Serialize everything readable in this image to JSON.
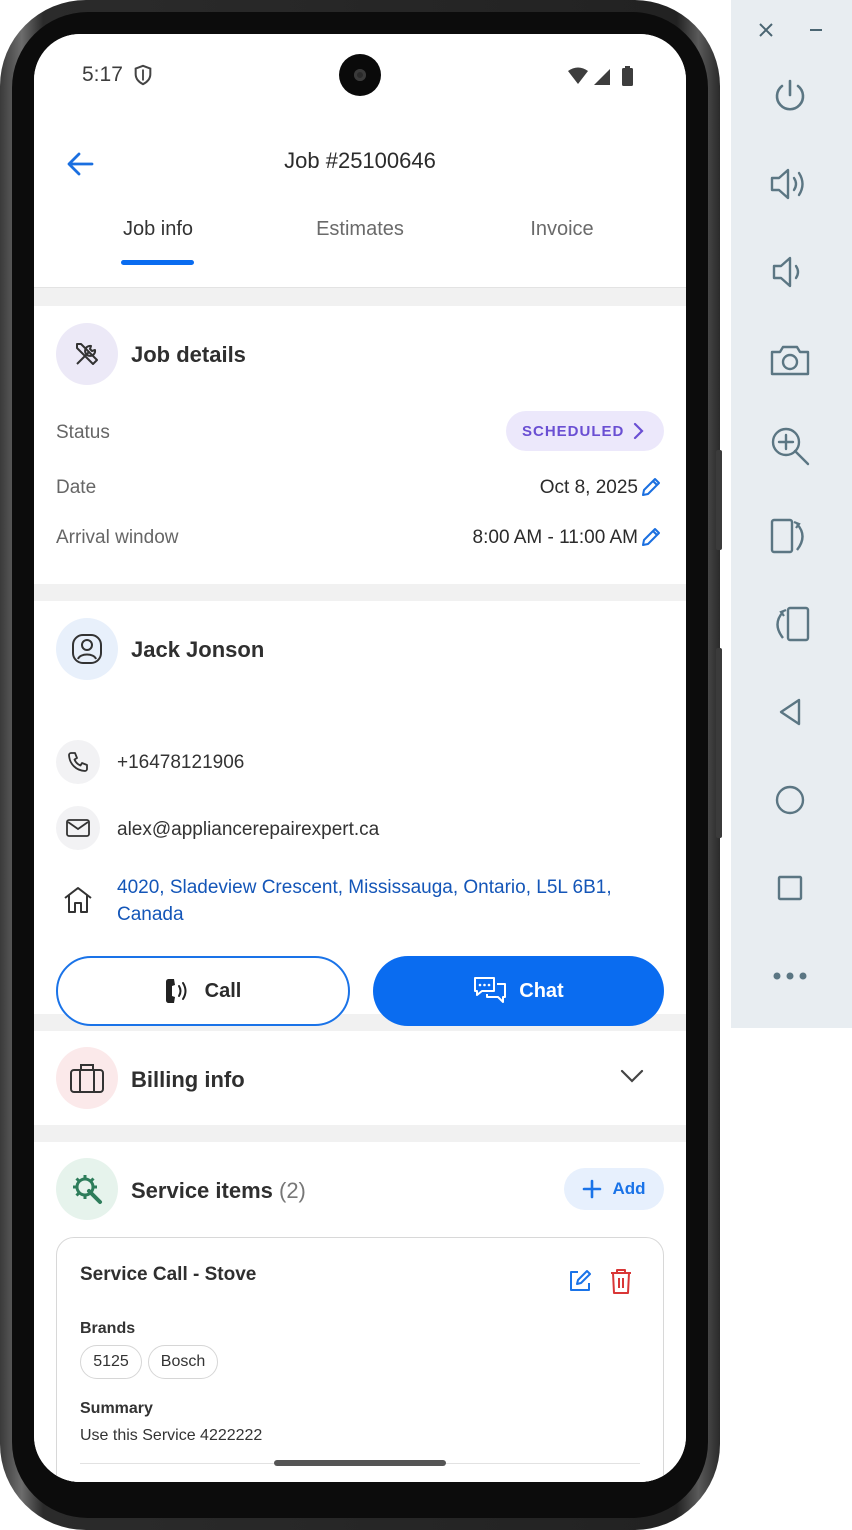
{
  "status_bar": {
    "time": "5:17"
  },
  "app_bar": {
    "title": "Job #25100646"
  },
  "tabs": [
    {
      "label": "Job info",
      "active": true
    },
    {
      "label": "Estimates",
      "active": false
    },
    {
      "label": "Invoice",
      "active": false
    }
  ],
  "job_details": {
    "heading": "Job details",
    "status_label": "Status",
    "status_value": "SCHEDULED",
    "date_label": "Date",
    "date_value": "Oct 8, 2025",
    "arrival_label": "Arrival window",
    "arrival_value": "8:00 AM - 11:00 AM"
  },
  "customer": {
    "name": "Jack Jonson",
    "phone": "+16478121906",
    "email": "alex@appliancerepairexpert.ca",
    "address": "4020, Sladeview Crescent, Mississauga, Ontario, L5L 6B1, Canada",
    "call_label": "Call",
    "chat_label": "Chat"
  },
  "billing": {
    "heading": "Billing info"
  },
  "service_items": {
    "heading": "Service items",
    "count": "(2)",
    "add_label": "Add",
    "items": [
      {
        "title": "Service Call - Stove",
        "brands_label": "Brands",
        "brands": [
          "5125",
          "Bosch"
        ],
        "summary_label": "Summary",
        "summary": "Use this Service 4222222"
      }
    ]
  },
  "colors": {
    "primary": "#0a6cf0",
    "status_chip_bg": "#ece8fb",
    "status_chip_text": "#6a4fd3",
    "link": "#1456b8",
    "delete": "#d93636",
    "service_icon": "#2e7d5b"
  },
  "icons": {
    "back": "arrow-left-icon",
    "job_details": "tools-icon",
    "customer": "user-circle-icon",
    "phone": "phone-icon",
    "email": "mail-icon",
    "address": "home-icon",
    "billing": "briefcase-icon",
    "service": "gear-wrench-icon",
    "edit": "edit-icon",
    "delete": "trash-icon"
  },
  "emulator_toolbar": {
    "buttons": [
      "power-icon",
      "volume-up-icon",
      "volume-down-icon",
      "camera-icon",
      "zoom-in-icon",
      "rotate-right-icon",
      "rotate-left-icon",
      "back-icon",
      "home-icon",
      "overview-icon",
      "more-icon"
    ]
  }
}
